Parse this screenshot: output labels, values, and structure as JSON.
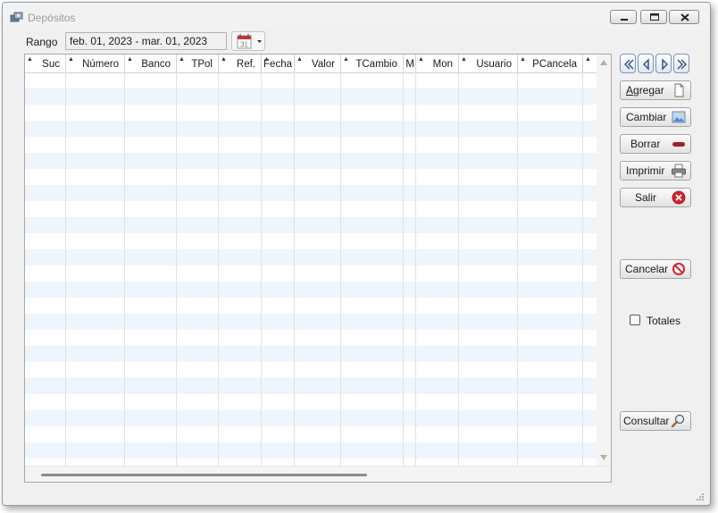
{
  "window": {
    "title": "Depósitos",
    "icons": {
      "app": "deposit-icon",
      "minimize": "minimize-icon",
      "maximize": "maximize-icon",
      "close": "close-icon"
    }
  },
  "filter": {
    "rango_label": "Rango",
    "range_value": "feb. 01, 2023 - mar. 01, 2023",
    "calendar_icon": "calendar-icon",
    "calendar_day": "31"
  },
  "grid": {
    "columns": [
      {
        "label": "Suc"
      },
      {
        "label": "Número"
      },
      {
        "label": "Banco"
      },
      {
        "label": "TPol"
      },
      {
        "label": "Ref."
      },
      {
        "label": "Fecha"
      },
      {
        "label": "Valor"
      },
      {
        "label": "TCambio"
      },
      {
        "label": "M"
      },
      {
        "label": "Mon"
      },
      {
        "label": "Usuario"
      },
      {
        "label": "PCancela"
      },
      {
        "label": ""
      }
    ]
  },
  "navigation": {
    "icons": [
      "first-icon",
      "previous-icon",
      "next-icon",
      "last-icon"
    ]
  },
  "actions": {
    "agregar": {
      "label_underlined": "A",
      "label_rest": "gregar",
      "icon": "new-document-icon"
    },
    "cambiar": {
      "label": "Cambiar",
      "icon": "edit-image-icon"
    },
    "borrar": {
      "label": "Borrar",
      "icon": "minus-icon"
    },
    "imprimir": {
      "label": "Imprimir",
      "icon": "printer-icon"
    },
    "salir": {
      "label": "Salir",
      "icon": "exit-icon"
    },
    "cancelar": {
      "label": "Cancelar",
      "icon": "no-entry-icon"
    },
    "consultar": {
      "label": "Consultar",
      "icon": "magnifier-icon"
    }
  },
  "options": {
    "totales_label": "Totales",
    "totales_checked": false
  },
  "colors": {
    "row_alt": "#eef5fc",
    "nav_border": "#7b93b8",
    "close_red": "#d6222a",
    "borrar_red": "#a0202a"
  }
}
